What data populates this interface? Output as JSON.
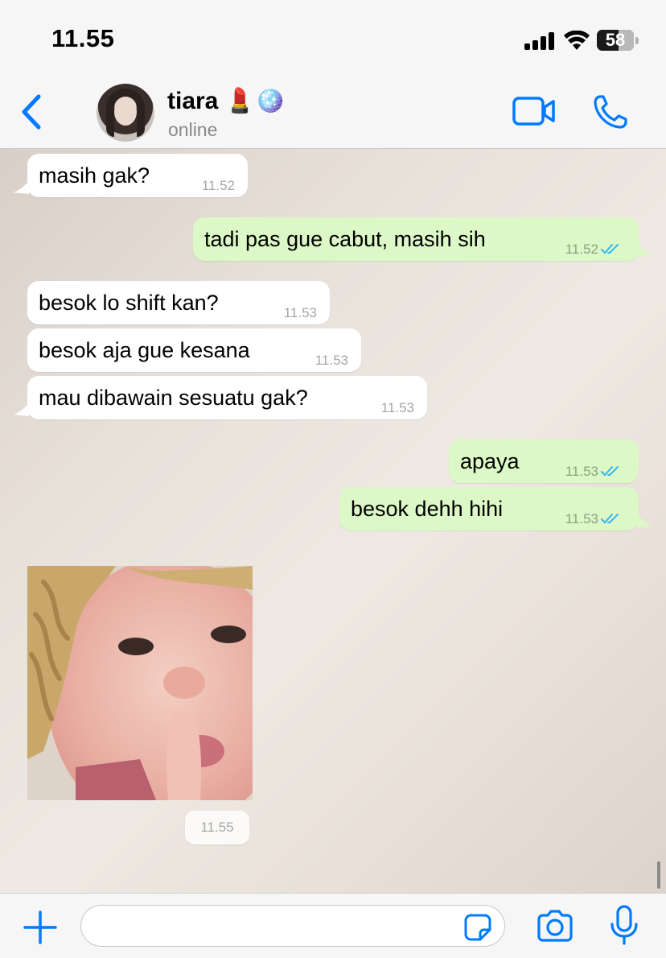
{
  "status_bar": {
    "time": "11.55",
    "battery": "58",
    "battery_level": 0.58
  },
  "header": {
    "contact_name": "tiara",
    "contact_emoji": "💄🪩",
    "contact_status": "online",
    "icons": [
      "chevron-left-icon",
      "video-call-icon",
      "phone-icon"
    ]
  },
  "messages": [
    {
      "direction": "in",
      "text": "masih gak?",
      "time": "11.52"
    },
    {
      "direction": "out",
      "text": "tadi pas gue cabut, masih sih",
      "time": "11.52",
      "read": true
    },
    {
      "direction": "in",
      "text": "besok lo shift kan?",
      "time": "11.53"
    },
    {
      "direction": "in",
      "text": "besok aja gue kesana",
      "time": "11.53"
    },
    {
      "direction": "in",
      "text": "mau dibawain sesuatu gak?",
      "time": "11.53"
    },
    {
      "direction": "out",
      "text": "apaya",
      "time": "11.53",
      "read": true
    },
    {
      "direction": "out",
      "text": "besok dehh hihi",
      "time": "11.53",
      "read": true
    },
    {
      "direction": "in",
      "type": "image",
      "time": "11.55"
    }
  ],
  "input_bar": {
    "placeholder": "",
    "icons": [
      "plus-icon",
      "sticker-icon",
      "camera-icon",
      "microphone-icon"
    ]
  },
  "colors": {
    "accent": "#007aff",
    "outgoing_bubble": "#dcf8c6",
    "incoming_bubble": "#ffffff",
    "read_ticks": "#34b7f1"
  }
}
